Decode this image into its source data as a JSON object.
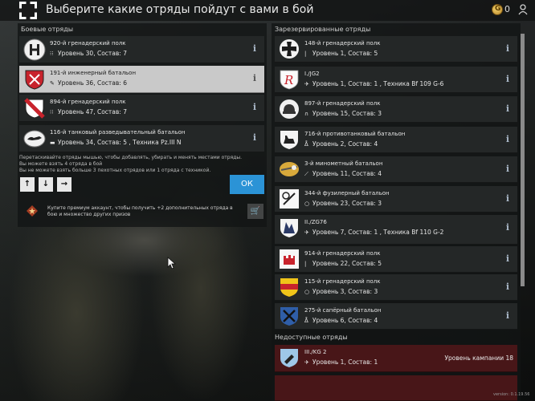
{
  "header": {
    "title": "Выберите какие отряды пойдут с вами в бой",
    "currency": "0"
  },
  "battle_units": {
    "label": "Боевые отряды",
    "items": [
      {
        "name": "920-й гренадерский полк",
        "stats": "Уровень 30, Состав: 7",
        "emblem": "grenadier-emblem-icon",
        "selected": false
      },
      {
        "name": "191-й инженерный батальон",
        "stats": "Уровень 36, Состав: 6",
        "emblem": "engineer-emblem-icon",
        "selected": true
      },
      {
        "name": "894-й гренадерский полк",
        "stats": "Уровень 47, Состав: 7",
        "emblem": "grenadier-emblem-icon",
        "selected": false
      },
      {
        "name": "116-й танковый разведывательный батальон",
        "stats": "Уровень 34, Состав: 5 , Техника Pz.III N",
        "emblem": "greyhound-emblem-icon",
        "selected": false
      }
    ]
  },
  "hint": {
    "line1": "Перетаскивайте отряды мышью, чтобы добавлять, убирать и менять местами отряды.",
    "line2": "Вы можете взять 4 отряда в бой",
    "line3": "Вы не можете взять больше 3 пехотных отрядов или 1 отряда с техникой."
  },
  "controls": {
    "up_icon": "↑",
    "down_icon": "↓",
    "right_icon": "→",
    "ok_label": "ОК"
  },
  "premium": {
    "text": "Купите премиум аккаунт, чтобы получить +2 дополнительных отряда в бою и множество других призов",
    "cart_icon": "🛒"
  },
  "reserve_units": {
    "label": "Зарезервированные отряды",
    "items": [
      {
        "name": "148-й гренадерский полк",
        "stats": "Уровень 1, Состав: 5"
      },
      {
        "name": "I./JG2",
        "stats": "Уровень 1, Состав: 1 , Техника Bf 109 G-6"
      },
      {
        "name": "897-й гренадерский полк",
        "stats": "Уровень 15, Состав: 3"
      },
      {
        "name": "716-й противотанковый батальон",
        "stats": "Уровень 2, Состав: 4"
      },
      {
        "name": "3-й минометный батальон",
        "stats": "Уровень 11, Состав: 4"
      },
      {
        "name": "344-й фузилерный батальон",
        "stats": "Уровень 23, Состав: 3"
      },
      {
        "name": "II./ZG76",
        "stats": "Уровень 7, Состав: 1 , Техника Bf 110 G-2"
      },
      {
        "name": "914-й гренадерский полк",
        "stats": "Уровень 22, Состав: 5"
      },
      {
        "name": "115-й гренадерский полк",
        "stats": "Уровень 3, Состав: 3"
      },
      {
        "name": "275-й сапёрный батальон",
        "stats": "Уровень 6, Состав: 4"
      }
    ]
  },
  "unavailable_units": {
    "label": "Недоступные отряды",
    "items": [
      {
        "name": "III./KG 2",
        "stats": "Уровень 1, Состав: 1",
        "requirement": "Уровень кампании 18"
      }
    ]
  },
  "info_glyph": "i",
  "version": "version: 0.1.19.56",
  "colors": {
    "accent_blue": "#2b93d6",
    "selected_row": "#c9c9c9",
    "unavailable_row": "#4c1618"
  }
}
